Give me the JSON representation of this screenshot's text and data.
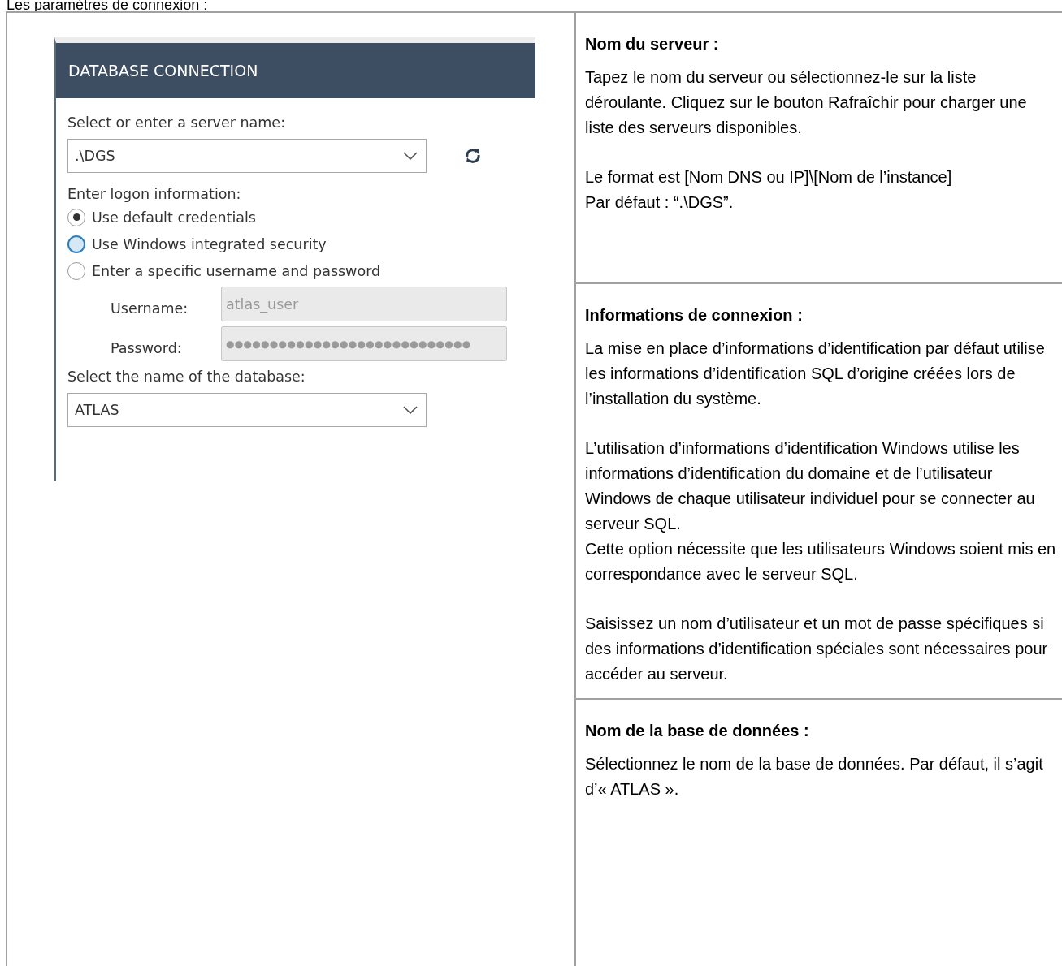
{
  "intro": "Les paramètres de connexion :",
  "dialog": {
    "title": "DATABASE CONNECTION",
    "server_label": "Select or enter a server name:",
    "server_value": ".\\DGS",
    "logon_label": "Enter logon information:",
    "options": [
      {
        "label": "Use default credentials",
        "selected": true,
        "hovered": false
      },
      {
        "label": "Use Windows integrated security",
        "selected": false,
        "hovered": true
      },
      {
        "label": "Enter a specific username and password",
        "selected": false,
        "hovered": false
      }
    ],
    "credentials": [
      {
        "label": "Username:",
        "value": "atlas_user",
        "kind": "text",
        "disabled": true
      },
      {
        "label": "Password:",
        "value": "●●●●●●●●●●●●●●●●●●●●●●●●●●●●",
        "kind": "password",
        "disabled": true
      }
    ],
    "database_label": "Select the name of the database:",
    "database_value": "ATLAS"
  },
  "notes": [
    {
      "heading": "Nom du serveur :",
      "paragraphs": [
        [
          "Tapez le nom du serveur ou sélectionnez-le sur la liste déroulante. Cliquez sur le bouton Rafraîchir pour charger une liste des serveurs disponibles."
        ],
        [
          "Le format est [Nom DNS ou IP]\\[Nom de l’instance]",
          "Par défaut : “.\\DGS”."
        ]
      ]
    },
    {
      "heading": "Informations de connexion :",
      "paragraphs": [
        [
          "La mise en place d’informations d’identification par défaut utilise les informations d’identification SQL d’origine créées lors de l’installation du système."
        ],
        [
          "L’utilisation d’informations d’identification Windows utilise les informations d’identification du domaine et de l’utilisateur Windows de chaque utilisateur individuel pour se connecter au serveur SQL.",
          "Cette option nécessite que les utilisateurs Windows soient mis en correspondance avec le serveur SQL."
        ],
        [
          "Saisissez un nom d’utilisateur et un mot de passe spécifiques si des informations d’identification spéciales sont nécessaires pour accéder au serveur."
        ]
      ]
    },
    {
      "heading": "Nom de la base de données :",
      "paragraphs": [
        [
          "Sélectionnez le nom de la base de données. Par défaut, il s’agit d’« ATLAS »."
        ]
      ]
    }
  ]
}
